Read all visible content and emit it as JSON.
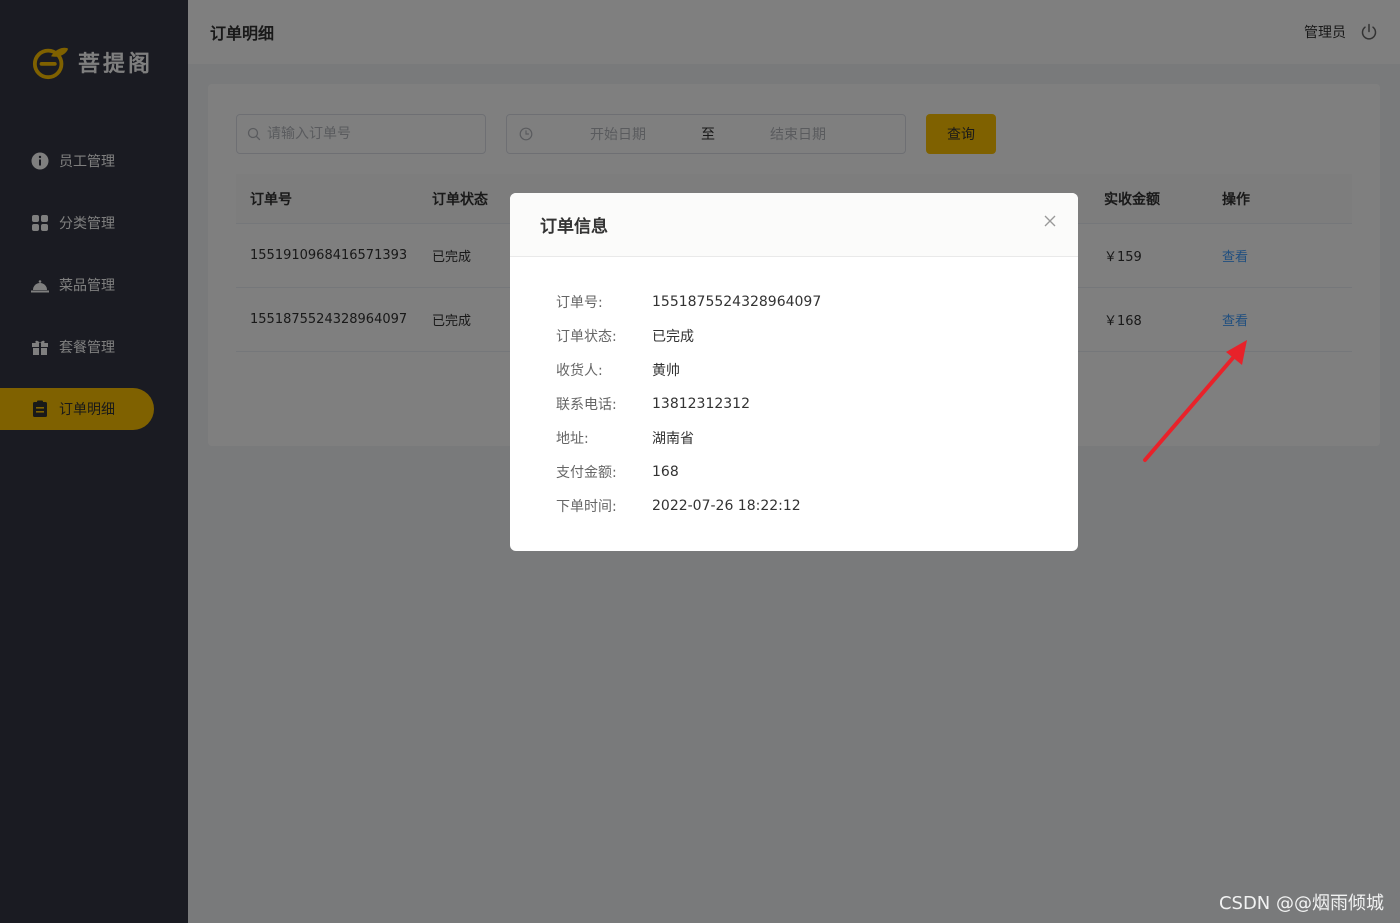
{
  "app": {
    "logo_text": "菩提阁",
    "brand_color": "#ffc200"
  },
  "sidebar": {
    "items": [
      {
        "label": "员工管理",
        "icon": "info-icon",
        "active": false
      },
      {
        "label": "分类管理",
        "icon": "grid-icon",
        "active": false
      },
      {
        "label": "菜品管理",
        "icon": "dish-cover-icon",
        "active": false
      },
      {
        "label": "套餐管理",
        "icon": "gift-icon",
        "active": false
      },
      {
        "label": "订单明细",
        "icon": "clipboard-icon",
        "active": true
      }
    ]
  },
  "header": {
    "title": "订单明细",
    "user": "管理员",
    "power_icon": "power-icon"
  },
  "toolbar": {
    "search_placeholder": "请输入订单号",
    "date_start_placeholder": "开始日期",
    "date_separator": "至",
    "date_end_placeholder": "结束日期",
    "query_label": "查询"
  },
  "table": {
    "columns": {
      "order_no": "订单号",
      "status": "订单状态",
      "amount": "实收金额",
      "operation": "操作"
    },
    "rows": [
      {
        "order_no": "1551910968416571393",
        "status": "已完成",
        "amount": "￥159",
        "action": "查看"
      },
      {
        "order_no": "1551875524328964097",
        "status": "已完成",
        "amount": "￥168",
        "action": "查看"
      }
    ]
  },
  "dialog": {
    "title": "订单信息",
    "fields": [
      {
        "label": "订单号:",
        "value": "1551875524328964097"
      },
      {
        "label": "订单状态:",
        "value": "已完成"
      },
      {
        "label": "收货人:",
        "value": "黄帅"
      },
      {
        "label": "联系电话:",
        "value": "13812312312"
      },
      {
        "label": "地址:",
        "value": "湖南省"
      },
      {
        "label": "支付金额:",
        "value": "168"
      },
      {
        "label": "下单时间:",
        "value": "2022-07-26 18:22:12"
      }
    ]
  },
  "watermark": "CSDN @@烟雨倾城",
  "annotation_color": "#e8222a"
}
